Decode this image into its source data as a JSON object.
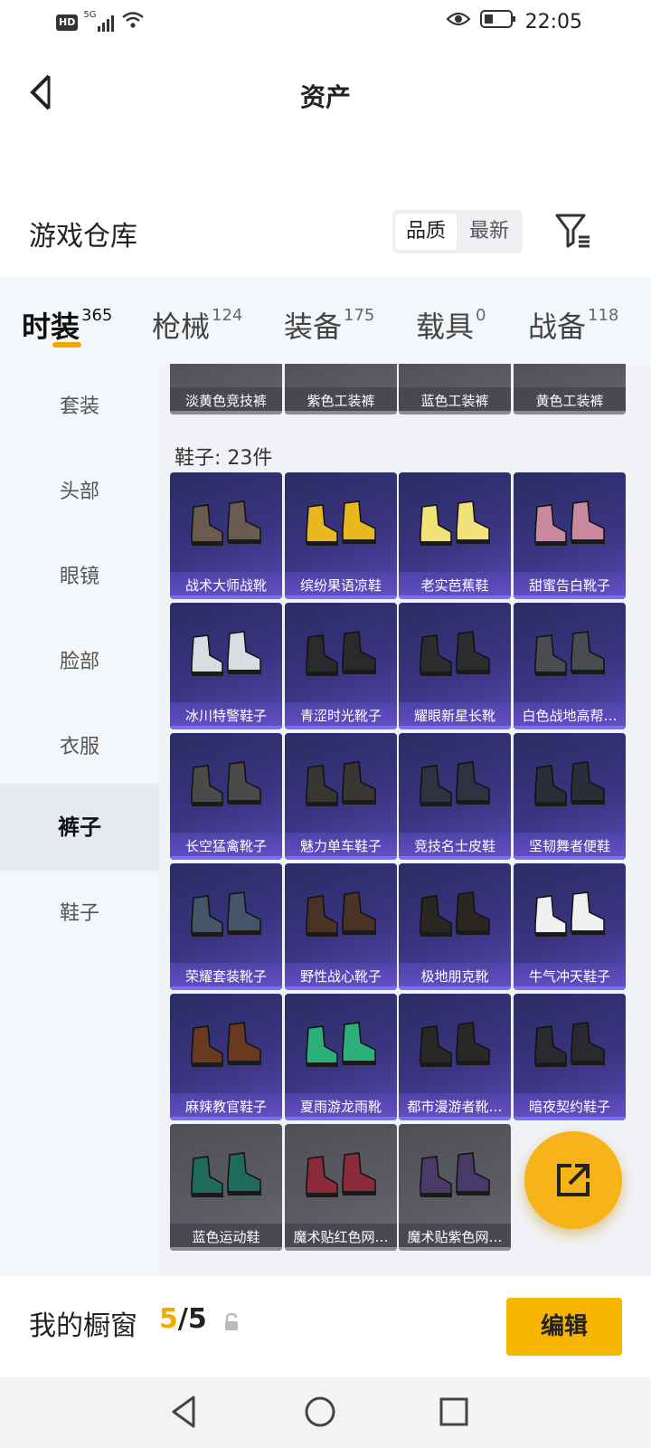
{
  "status_bar": {
    "hd": "HD",
    "network": "5G",
    "time": "22:05"
  },
  "header": {
    "title": "资产"
  },
  "warehouse": {
    "title": "游戏仓库",
    "sort_options": [
      "品质",
      "最新"
    ]
  },
  "tabs": [
    {
      "label": "时装",
      "count": "365"
    },
    {
      "label": "枪械",
      "count": "124"
    },
    {
      "label": "装备",
      "count": "175"
    },
    {
      "label": "载具",
      "count": "0"
    },
    {
      "label": "战备",
      "count": "118"
    }
  ],
  "sidebar": [
    "套装",
    "头部",
    "眼镜",
    "脸部",
    "衣服",
    "裤子",
    "鞋子"
  ],
  "pants_row": [
    "淡黄色竞技裤",
    "紫色工装裤",
    "蓝色工装裤",
    "黄色工装裤"
  ],
  "shoes_section": {
    "title": "鞋子: 23件"
  },
  "shoes": [
    "战术大师战靴",
    "缤纷果语凉鞋",
    "老实芭蕉鞋",
    "甜蜜告白靴子",
    "冰川特警鞋子",
    "青涩时光靴子",
    "耀眼新星长靴",
    "白色战地高帮…",
    "长空猛禽靴子",
    "魅力单车鞋子",
    "竞技名士皮鞋",
    "坚韧舞者便鞋",
    "荣耀套装靴子",
    "野性战心靴子",
    "极地朋克靴",
    "牛气冲天鞋子",
    "麻辣教官鞋子",
    "夏雨游龙雨靴",
    "都市漫游者靴…",
    "暗夜契约鞋子",
    "蓝色运动鞋",
    "魔术贴红色网…",
    "魔术贴紫色网…"
  ],
  "shoe_colors": [
    "#6a5a50",
    "#e8b820",
    "#f2e27a",
    "#c98aa0",
    "#d8dde2",
    "#2a2a2c",
    "#2c2c2e",
    "#4a4c52",
    "#4a4a4a",
    "#3a3634",
    "#2e3340",
    "#2a2e38",
    "#46546a",
    "#4a3226",
    "#2a2622",
    "#f0f0f0",
    "#6a3a20",
    "#2bb07a",
    "#2a2826",
    "#2a2a2e",
    "#1f6a5a",
    "#8a2a3a",
    "#4a3a6a"
  ],
  "footer": {
    "label": "我的橱窗",
    "current": "5",
    "total": "/5",
    "edit": "编辑"
  }
}
